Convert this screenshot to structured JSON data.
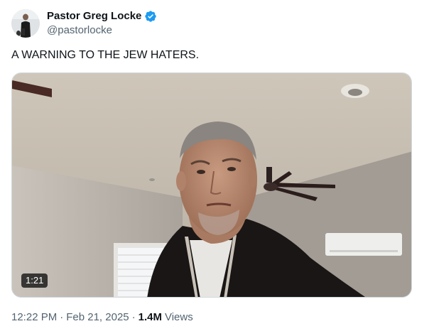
{
  "author": {
    "display_name": "Pastor Greg Locke",
    "handle": "@pastorlocke",
    "verified_badge_icon": "verified-badge-icon",
    "badge_color": "#1d9bf0"
  },
  "tweet": {
    "text": "A WARNING TO THE JEW HATERS."
  },
  "media": {
    "type": "video",
    "duration": "1:21"
  },
  "meta": {
    "time": "12:22 PM",
    "separator": "·",
    "date": "Feb 21, 2025",
    "views_count": "1.4M",
    "views_label": "Views"
  }
}
